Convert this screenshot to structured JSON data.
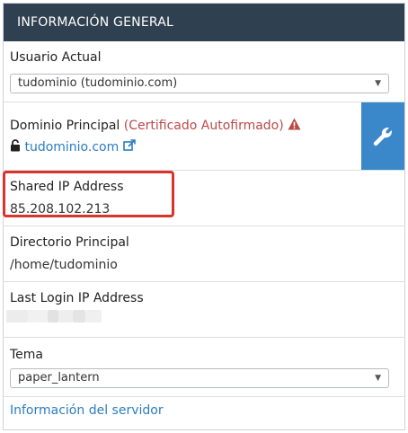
{
  "panel": {
    "title": "INFORMACIÓN GENERAL",
    "usuario_actual": {
      "label": "Usuario Actual",
      "selected": "tudominio (tudominio.com)"
    },
    "dominio_principal": {
      "label": "Dominio Principal",
      "warning": "(Certificado Autofirmado)",
      "domain_link": "tudominio.com"
    },
    "shared_ip": {
      "label": "Shared IP Address",
      "value": "85.208.102.213"
    },
    "directorio": {
      "label": "Directorio Principal",
      "value": "/home/tudominio"
    },
    "last_login": {
      "label": "Last Login IP Address"
    },
    "tema": {
      "label": "Tema",
      "selected": "paper_lantern"
    },
    "server_info_link": "Información del servidor"
  },
  "colors": {
    "header_bg": "#2f4050",
    "accent_blue": "#3a88c9",
    "link": "#2b7dbf",
    "warning": "#b94a48",
    "highlight": "#d9332b"
  },
  "icons": [
    "warning-triangle-icon",
    "unlock-icon",
    "external-link-icon",
    "wrench-icon",
    "chevron-down-icon"
  ]
}
